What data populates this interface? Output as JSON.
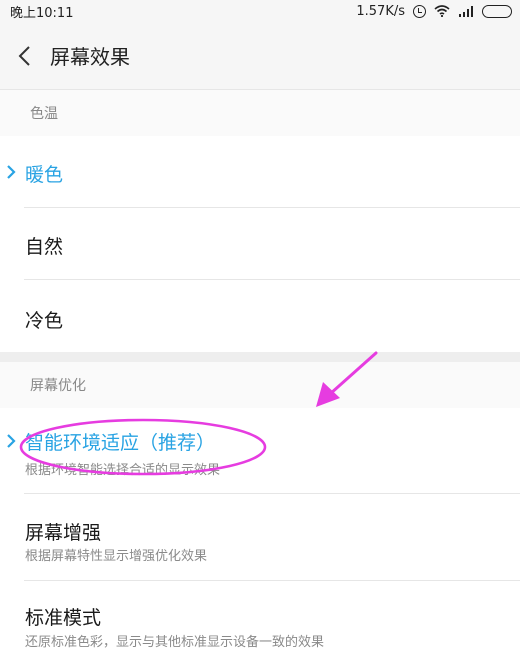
{
  "status_bar": {
    "time": "晚上10:11",
    "net_speed": "1.57K/s",
    "icons": [
      "alarm-icon",
      "wifi-icon",
      "signal-icon",
      "battery-icon"
    ]
  },
  "header": {
    "back_icon": "chevron-left-icon",
    "title": "屏幕效果"
  },
  "color_temperature": {
    "section_label": "色温",
    "options": [
      {
        "label": "暖色",
        "selected": true
      },
      {
        "label": "自然",
        "selected": false
      },
      {
        "label": "冷色",
        "selected": false
      }
    ]
  },
  "screen_optimization": {
    "section_label": "屏幕优化",
    "options": [
      {
        "label": "智能环境适应（推荐）",
        "description": "根据环境智能选择合适的显示效果",
        "selected": true
      },
      {
        "label": "屏幕增强",
        "description": "根据屏幕特性显示增强优化效果",
        "selected": false
      },
      {
        "label": "标准模式",
        "description": "还原标准色彩，显示与其他标准显示设备一致的效果",
        "selected": false
      }
    ]
  },
  "colors": {
    "accent": "#29a3e3",
    "annotation": "#e63ce0"
  }
}
